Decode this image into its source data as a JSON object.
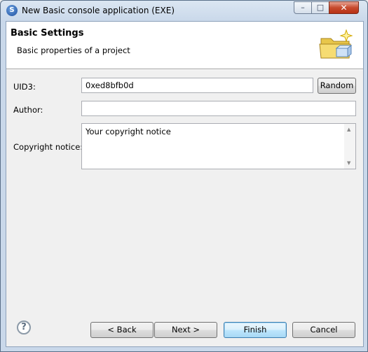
{
  "window": {
    "title": "New Basic console application (EXE)",
    "controls": {
      "minimize": "–",
      "maximize": "□",
      "close": "✕"
    }
  },
  "banner": {
    "title": "Basic Settings",
    "description": "Basic properties of a project",
    "icon": "new-project-folder-icon"
  },
  "form": {
    "uid3_label": "UID3:",
    "uid3_value": "0xed8bfb0d",
    "random_label": "Random",
    "author_label": "Author:",
    "author_value": "",
    "copyright_label": "Copyright notice:",
    "copyright_value": "Your copyright notice"
  },
  "footer": {
    "help_label": "?",
    "back_label": "< Back",
    "next_label": "Next >",
    "finish_label": "Finish",
    "cancel_label": "Cancel"
  },
  "colors": {
    "accent": "#3c7fb1",
    "titlebar": "#c9d8ea",
    "close_button": "#c74a2d"
  }
}
